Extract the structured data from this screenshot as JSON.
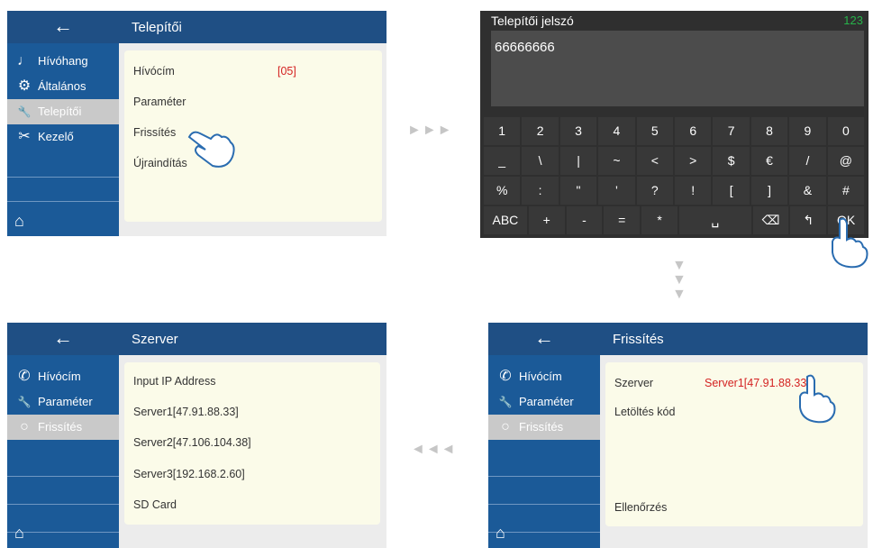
{
  "screen1": {
    "back": "←",
    "title": "Telepítői",
    "sidebar": [
      {
        "label": "Hívóhang",
        "icon": "music-note-icon",
        "glyph": "♩"
      },
      {
        "label": "Általános",
        "icon": "gear-icon",
        "glyph": "⚙"
      },
      {
        "label": "Telepítői",
        "icon": "wrench-icon",
        "glyph": "🔧"
      },
      {
        "label": "Kezelő",
        "icon": "tools-icon",
        "glyph": "✂"
      }
    ],
    "rows": [
      {
        "label": "Hívócím",
        "value": "[05]"
      },
      {
        "label": "Paraméter"
      },
      {
        "label": "Frissítés"
      },
      {
        "label": "Újraindítás"
      }
    ]
  },
  "arrow_right": "►►►",
  "arrow_left": "◄◄◄",
  "arrow_down": "▼",
  "keyboard": {
    "title": "Telepítői jelszó",
    "mode": "123",
    "input": "66666666",
    "rows": [
      [
        "1",
        "2",
        "3",
        "4",
        "5",
        "6",
        "7",
        "8",
        "9",
        "0"
      ],
      [
        "_",
        "\\",
        "|",
        "~",
        "<",
        ">",
        "$",
        "€",
        "/",
        "@"
      ],
      [
        "%",
        ":",
        "\"",
        "'",
        "?",
        "!",
        "[",
        "]",
        "&",
        "#"
      ],
      [
        "ABC",
        "+",
        "-",
        "=",
        "*",
        "␣",
        "⌫",
        "↰",
        "OK"
      ]
    ]
  },
  "screen3": {
    "back": "←",
    "title": "Szerver",
    "sidebar": [
      {
        "label": "Hívócím",
        "icon": "phone-icon",
        "glyph": "✆"
      },
      {
        "label": "Paraméter",
        "icon": "wrench-icon",
        "glyph": "🔧"
      },
      {
        "label": "Frissítés",
        "icon": "refresh-icon",
        "glyph": "○"
      }
    ],
    "rows": [
      {
        "label": "Input IP Address"
      },
      {
        "label": "Server1[47.91.88.33]"
      },
      {
        "label": "Server2[47.106.104.38]"
      },
      {
        "label": "Server3[192.168.2.60]"
      },
      {
        "label": "SD Card"
      }
    ]
  },
  "screen4": {
    "back": "←",
    "title": "Frissítés",
    "sidebar": [
      {
        "label": "Hívócím",
        "icon": "phone-icon",
        "glyph": "✆"
      },
      {
        "label": "Paraméter",
        "icon": "wrench-icon",
        "glyph": "🔧"
      },
      {
        "label": "Frissítés",
        "icon": "refresh-icon",
        "glyph": "○"
      }
    ],
    "rows": [
      {
        "label": "Szerver",
        "value": "Server1[47.91.88.33]"
      },
      {
        "label": "Letöltés kód"
      },
      {
        "label": "Ellenőrzés"
      }
    ]
  }
}
